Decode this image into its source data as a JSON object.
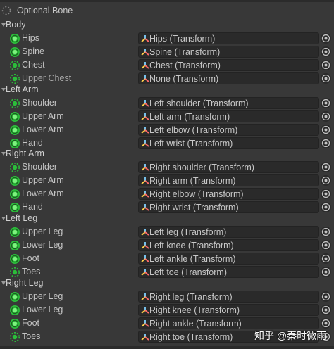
{
  "legend": {
    "label": "Optional Bone"
  },
  "colors": {
    "bone_green": "#2bbe3a",
    "background": "#383838",
    "field_bg": "#2a2a2a"
  },
  "groups": [
    {
      "label": "Body",
      "bones": [
        {
          "name": "Hips",
          "value": "Hips (Transform)",
          "dashed": false,
          "icon": "solid-circle-icon"
        },
        {
          "name": "Spine",
          "value": "Spine (Transform)",
          "dashed": false,
          "icon": "solid-circle-icon"
        },
        {
          "name": "Chest",
          "value": "Chest (Transform)",
          "dashed": true,
          "icon": "dashed-circle-icon"
        },
        {
          "name": "Upper Chest",
          "value": "None (Transform)",
          "dashed": true,
          "icon": "dashed-circle-icon",
          "empty": true
        }
      ]
    },
    {
      "label": "Left Arm",
      "bones": [
        {
          "name": "Shoulder",
          "value": "Left shoulder (Transform)",
          "dashed": true,
          "icon": "dashed-circle-icon"
        },
        {
          "name": "Upper Arm",
          "value": "Left arm (Transform)",
          "dashed": false,
          "icon": "solid-circle-icon"
        },
        {
          "name": "Lower Arm",
          "value": "Left elbow (Transform)",
          "dashed": false,
          "icon": "solid-circle-icon"
        },
        {
          "name": "Hand",
          "value": "Left wrist (Transform)",
          "dashed": false,
          "icon": "solid-circle-icon"
        }
      ]
    },
    {
      "label": "Right Arm",
      "bones": [
        {
          "name": "Shoulder",
          "value": "Right shoulder (Transform)",
          "dashed": true,
          "icon": "dashed-circle-icon"
        },
        {
          "name": "Upper Arm",
          "value": "Right arm (Transform)",
          "dashed": false,
          "icon": "solid-circle-icon"
        },
        {
          "name": "Lower Arm",
          "value": "Right elbow (Transform)",
          "dashed": false,
          "icon": "solid-circle-icon"
        },
        {
          "name": "Hand",
          "value": "Right wrist (Transform)",
          "dashed": false,
          "icon": "solid-circle-icon"
        }
      ]
    },
    {
      "label": "Left Leg",
      "bones": [
        {
          "name": "Upper Leg",
          "value": "Left leg (Transform)",
          "dashed": false,
          "icon": "solid-circle-icon"
        },
        {
          "name": "Lower Leg",
          "value": "Left knee (Transform)",
          "dashed": false,
          "icon": "solid-circle-icon"
        },
        {
          "name": "Foot",
          "value": "Left ankle (Transform)",
          "dashed": false,
          "icon": "solid-circle-icon"
        },
        {
          "name": "Toes",
          "value": "Left toe (Transform)",
          "dashed": true,
          "icon": "dashed-circle-icon"
        }
      ]
    },
    {
      "label": "Right Leg",
      "bones": [
        {
          "name": "Upper Leg",
          "value": "Right leg (Transform)",
          "dashed": false,
          "icon": "solid-circle-icon"
        },
        {
          "name": "Lower Leg",
          "value": "Right knee (Transform)",
          "dashed": false,
          "icon": "solid-circle-icon"
        },
        {
          "name": "Foot",
          "value": "Right ankle (Transform)",
          "dashed": false,
          "icon": "solid-circle-icon"
        },
        {
          "name": "Toes",
          "value": "Right toe (Transform)",
          "dashed": true,
          "icon": "dashed-circle-icon"
        }
      ]
    }
  ],
  "watermark": "知乎 @秦时微雨"
}
